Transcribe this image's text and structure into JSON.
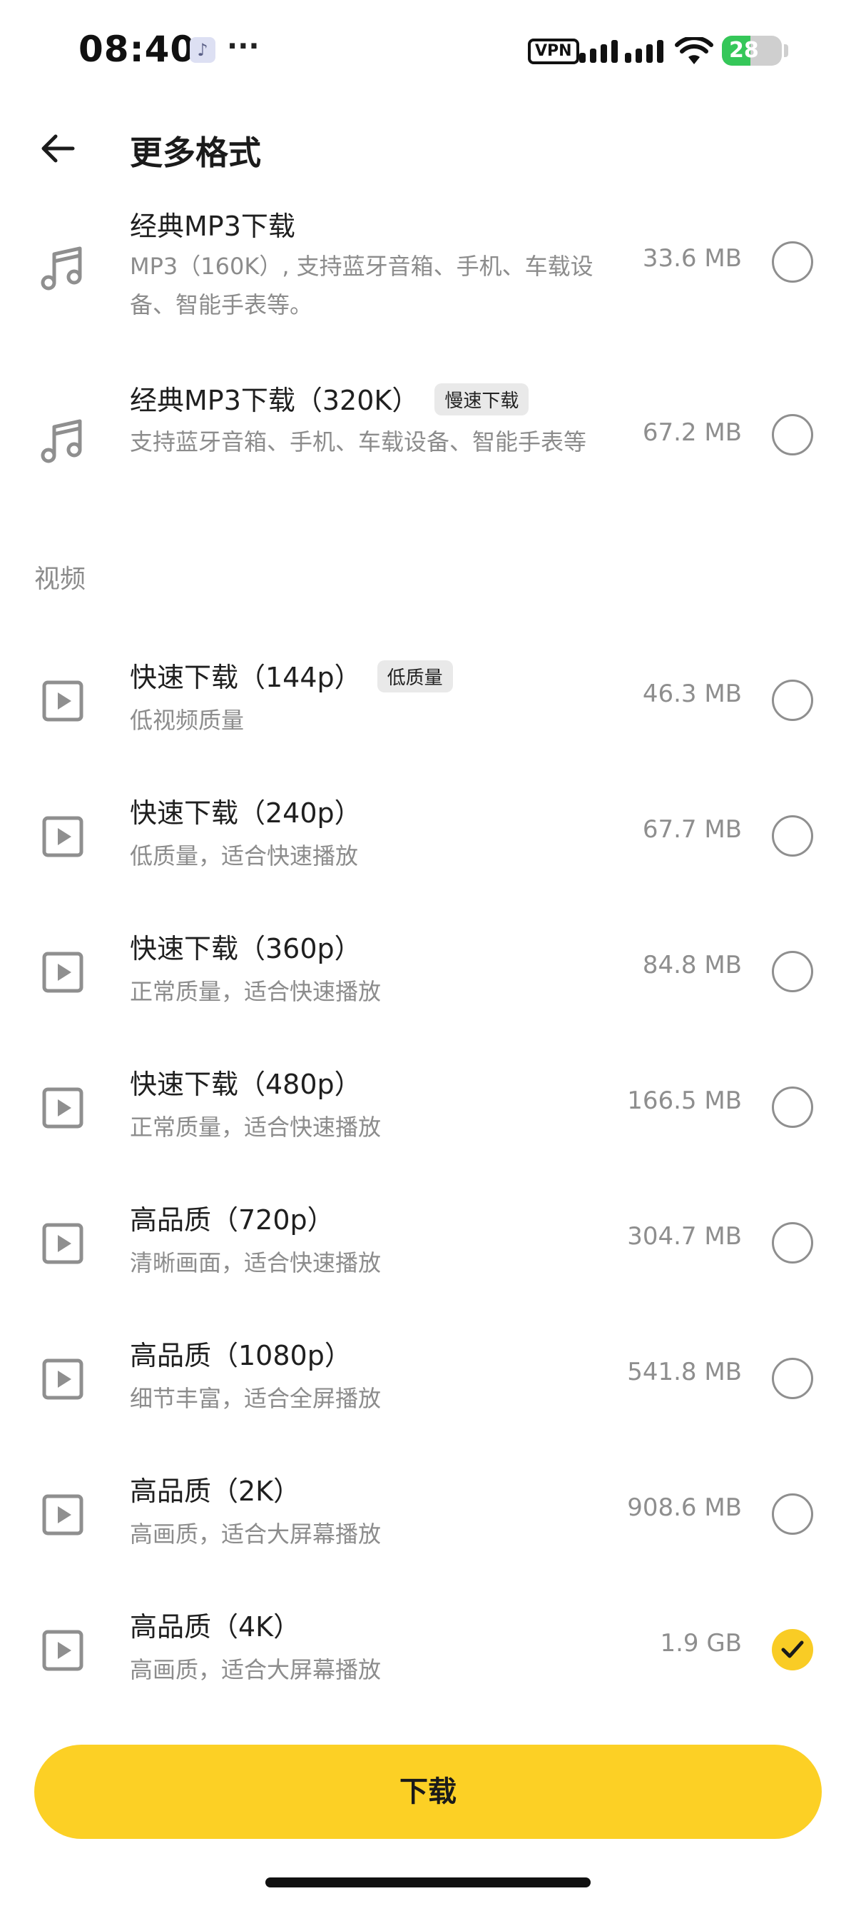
{
  "status_bar": {
    "time": "08:40",
    "music_icon": "music-note-icon",
    "dots": "···",
    "vpn": "VPN",
    "battery": "28"
  },
  "header": {
    "title": "更多格式",
    "back_icon": "arrow-left-icon"
  },
  "audio_items": [
    {
      "title": "经典MP3下载",
      "badge": "",
      "subtitle": "MP3（160K）, 支持蓝牙音箱、手机、车载设备、智能手表等。",
      "size": "33.6 MB",
      "selected": false,
      "icon": "music-note-icon"
    },
    {
      "title": "经典MP3下载（320K）",
      "badge": "慢速下载",
      "subtitle": "支持蓝牙音箱、手机、车载设备、智能手表等",
      "size": "67.2 MB",
      "selected": false,
      "icon": "music-note-icon"
    }
  ],
  "video_section_label": "视频",
  "video_items": [
    {
      "title": "快速下载（144p）",
      "badge": "低质量",
      "subtitle": "低视频质量",
      "size": "46.3 MB",
      "selected": false,
      "icon": "play-icon"
    },
    {
      "title": "快速下载（240p）",
      "badge": "",
      "subtitle": "低质量，适合快速播放",
      "size": "67.7 MB",
      "selected": false,
      "icon": "play-icon"
    },
    {
      "title": "快速下载（360p）",
      "badge": "",
      "subtitle": "正常质量，适合快速播放",
      "size": "84.8 MB",
      "selected": false,
      "icon": "play-icon"
    },
    {
      "title": "快速下载（480p）",
      "badge": "",
      "subtitle": "正常质量，适合快速播放",
      "size": "166.5 MB",
      "selected": false,
      "icon": "play-icon"
    },
    {
      "title": "高品质（720p）",
      "badge": "",
      "subtitle": "清晰画面，适合快速播放",
      "size": "304.7 MB",
      "selected": false,
      "icon": "play-icon"
    },
    {
      "title": "高品质（1080p）",
      "badge": "",
      "subtitle": "细节丰富，适合全屏播放",
      "size": "541.8 MB",
      "selected": false,
      "icon": "play-icon"
    },
    {
      "title": "高品质（2K）",
      "badge": "",
      "subtitle": "高画质，适合大屏幕播放",
      "size": "908.6 MB",
      "selected": false,
      "icon": "play-icon"
    },
    {
      "title": "高品质（4K）",
      "badge": "",
      "subtitle": "高画质，适合大屏幕播放",
      "size": "1.9 GB",
      "selected": true,
      "icon": "play-icon"
    }
  ],
  "download_button": {
    "label": "下载"
  },
  "colors": {
    "accent": "#fcd025",
    "muted_text": "#8c8c8c",
    "battery_green": "#35c759"
  }
}
